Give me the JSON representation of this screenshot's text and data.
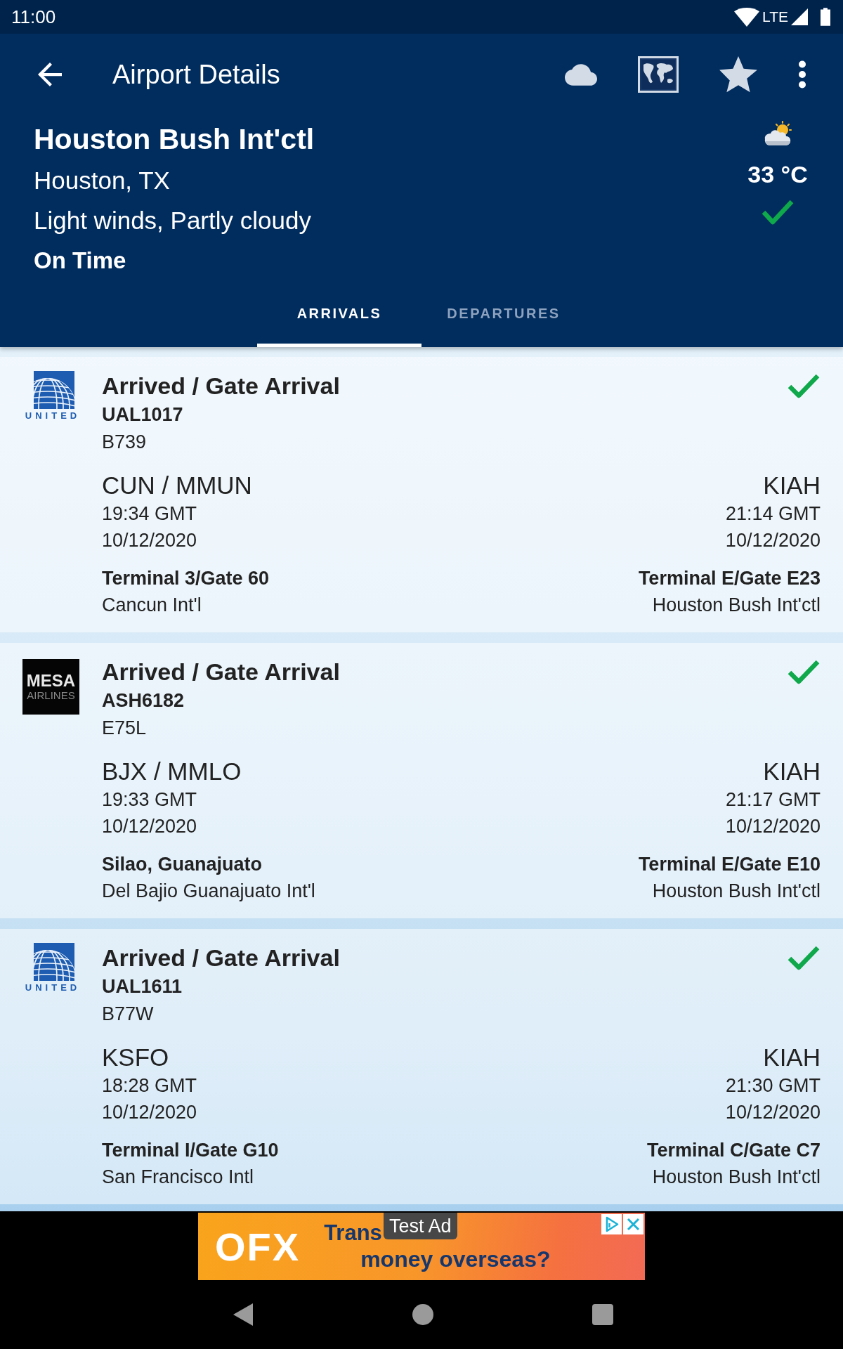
{
  "status_bar": {
    "time": "11:00",
    "network": "LTE"
  },
  "app_bar": {
    "title": "Airport Details"
  },
  "airport": {
    "name": "Houston Bush Int'ctl",
    "city": "Houston, TX",
    "conditions": "Light winds, Partly cloudy",
    "status": "On Time",
    "temperature": "33 °C"
  },
  "tabs": [
    {
      "label": "ARRIVALS",
      "selected": true
    },
    {
      "label": "DEPARTURES",
      "selected": false
    }
  ],
  "flights": [
    {
      "logo": {
        "kind": "globe",
        "text": "UNITED"
      },
      "status": "Arrived / Gate Arrival",
      "flight": "UAL1017",
      "aircraft": "B739",
      "origin": {
        "code": "CUN / MMUN",
        "time": "19:34 GMT",
        "date": "10/12/2020",
        "detail": "Terminal 3/Gate 60",
        "airport": "Cancun Int'l"
      },
      "destination": {
        "code": "KIAH",
        "time": "21:14 GMT",
        "date": "10/12/2020",
        "detail": "Terminal E/Gate E23",
        "airport": "Houston Bush Int'ctl"
      }
    },
    {
      "logo": {
        "kind": "wordmark",
        "text": "MESA",
        "subtext": "AIRLINES"
      },
      "status": "Arrived / Gate Arrival",
      "flight": "ASH6182",
      "aircraft": "E75L",
      "origin": {
        "code": "BJX / MMLO",
        "time": "19:33 GMT",
        "date": "10/12/2020",
        "detail": "Silao, Guanajuato",
        "airport": "Del Bajio Guanajuato Int'l"
      },
      "destination": {
        "code": "KIAH",
        "time": "21:17 GMT",
        "date": "10/12/2020",
        "detail": "Terminal E/Gate E10",
        "airport": "Houston Bush Int'ctl"
      }
    },
    {
      "logo": {
        "kind": "globe",
        "text": "UNITED"
      },
      "status": "Arrived / Gate Arrival",
      "flight": "UAL1611",
      "aircraft": "B77W",
      "origin": {
        "code": "KSFO",
        "time": "18:28 GMT",
        "date": "10/12/2020",
        "detail": "Terminal I/Gate G10",
        "airport": "San Francisco Intl"
      },
      "destination": {
        "code": "KIAH",
        "time": "21:30 GMT",
        "date": "10/12/2020",
        "detail": "Terminal C/Gate C7",
        "airport": "Houston Bush Int'ctl"
      }
    }
  ],
  "ad": {
    "logo": "OFX",
    "headline": "Trans",
    "subline": "money overseas?",
    "badge": "Test Ad"
  }
}
